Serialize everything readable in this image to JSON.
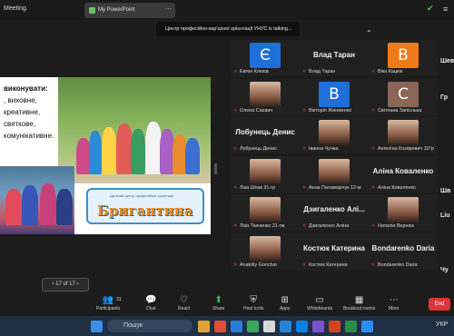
{
  "window": {
    "app_label": "Meeting",
    "tab_title": "My PowerPoint"
  },
  "banner": "Центр професійно-кар'єрної орієнтації УНУС is talking...",
  "slide": {
    "text_heading": "виконувати:",
    "text_lines": [
      ", виховне,",
      "креативне,",
      "святкове,",
      "комунікативне."
    ],
    "logo_top": "Дитячий центр професійної орієнтації",
    "logo_text": "Бригантина"
  },
  "pager": "17 of 17",
  "participants": [
    {
      "name": "Евген Клюєв",
      "avatar": "Є",
      "color": "#1e6fd9",
      "kind": "letter"
    },
    {
      "name": "Влад Таран",
      "big": "Влад Таран",
      "kind": "text"
    },
    {
      "name": "Віка Кацюк",
      "avatar": "В",
      "color": "#f07a17",
      "kind": "letter"
    },
    {
      "name": "Олена Саєвич",
      "kind": "photo"
    },
    {
      "name": "Вікторія Жинженко",
      "avatar": "В",
      "color": "#1e6fd9",
      "kind": "letter"
    },
    {
      "name": "Світлана Запіснька",
      "avatar": "С",
      "color": "#8b6555",
      "kind": "letter"
    },
    {
      "name": "Лобунець Денис",
      "big": "Лобунець Денис",
      "kind": "text"
    },
    {
      "name": "Іванна Чучка",
      "kind": "photo"
    },
    {
      "name": "Ангеліна Козяревич 11Гр",
      "kind": "photo"
    },
    {
      "name": "Ліза Шпак 31-гр",
      "kind": "photo"
    },
    {
      "name": "Анна Паламарчук 12-м",
      "kind": "photo"
    },
    {
      "name": "Аліна Коваленко",
      "big": "Аліна Коваленко",
      "kind": "text"
    },
    {
      "name": "Ліза Ткаченко 21-гм",
      "kind": "photo"
    },
    {
      "name": "Дзигаленко Аліна",
      "big": "Дзигаленко Алі...",
      "kind": "text"
    },
    {
      "name": "Наталія Вернюк",
      "kind": "photo"
    },
    {
      "name": "Anatoliy Gonchar",
      "kind": "photo"
    },
    {
      "name": "Костюк Катерина",
      "big": "Костюк Катерина",
      "kind": "text"
    },
    {
      "name": "Bondarenko Daria",
      "big": "Bondarenko Daria",
      "kind": "text"
    }
  ],
  "edge_labels": [
    "Шев",
    "Гр",
    "Шв",
    "Liu",
    "Чу"
  ],
  "toolbar": {
    "participants": "Participants",
    "participants_count": "31",
    "chat": "Chat",
    "react": "React",
    "share": "Share",
    "host_tools": "Host tools",
    "apps": "Apps",
    "whiteboards": "Whiteboards",
    "breakout": "Breakout rooms",
    "more": "More",
    "end": "End"
  },
  "taskbar": {
    "search": "Пошук",
    "lang": "УКР"
  }
}
